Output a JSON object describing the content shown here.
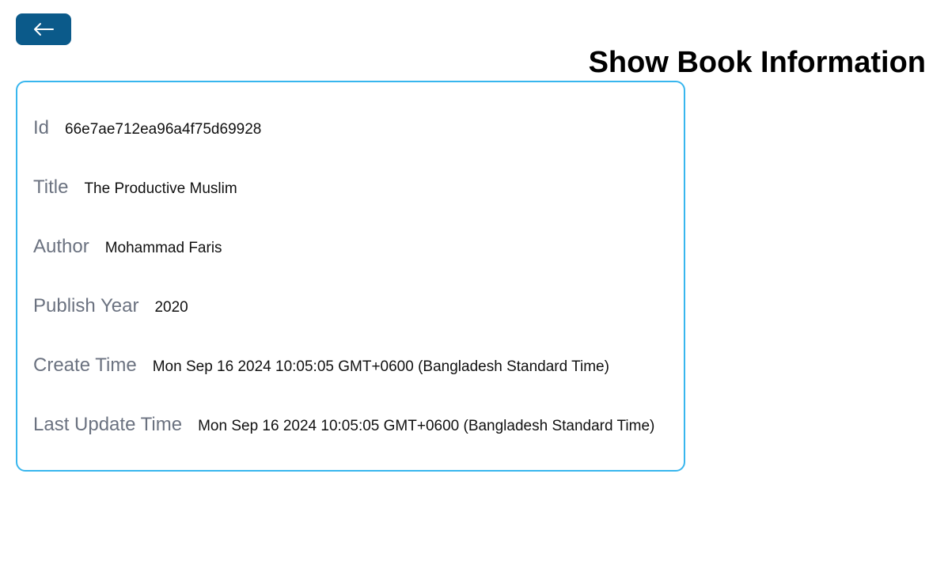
{
  "header": {
    "title": "Show Book Information",
    "back_icon": "arrow-left-icon",
    "back_color": "#0b5a8a"
  },
  "card": {
    "border_color": "#38b6ee",
    "rows": [
      {
        "label": "Id",
        "value": "66e7ae712ea96a4f75d69928"
      },
      {
        "label": "Title",
        "value": "The Productive Muslim"
      },
      {
        "label": "Author",
        "value": "Mohammad Faris"
      },
      {
        "label": "Publish Year",
        "value": "2020"
      },
      {
        "label": "Create Time",
        "value": "Mon Sep 16 2024 10:05:05 GMT+0600 (Bangladesh Standard Time)"
      },
      {
        "label": "Last Update Time",
        "value": "Mon Sep 16 2024 10:05:05 GMT+0600 (Bangladesh Standard Time)"
      }
    ]
  }
}
